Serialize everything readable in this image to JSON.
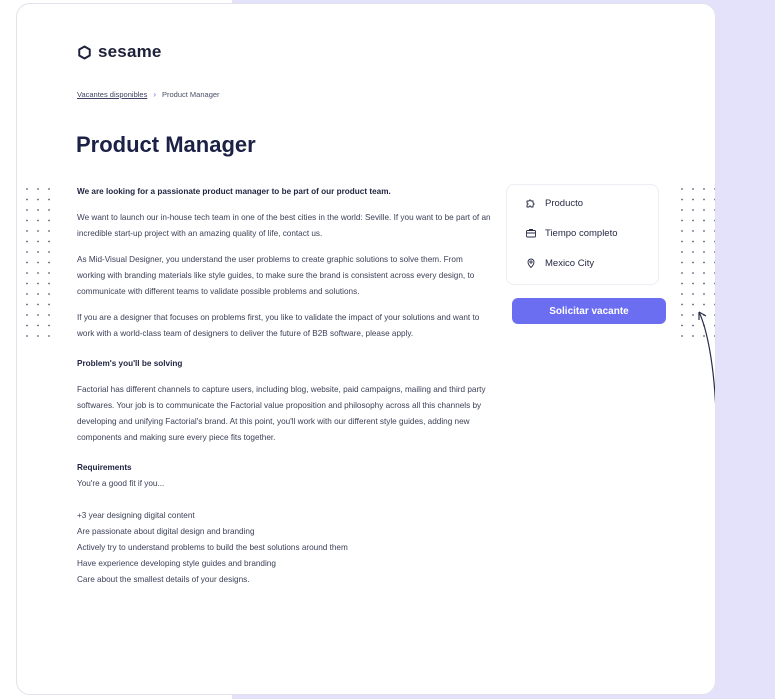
{
  "brand": {
    "name": "sesame"
  },
  "breadcrumb": {
    "parent": "Vacantes disponibles",
    "separator": "›",
    "current": "Product Manager"
  },
  "job": {
    "title": "Product Manager",
    "lead": "We are looking for a passionate product manager to be part of our product team.",
    "paragraphs": [
      "We want to launch our in-house tech team in one of the best cities in the world: Seville. If you want to be part of an incredible start-up project with an amazing quality of life, contact us.",
      "As Mid-Visual Designer, you understand the user problems to create graphic solutions to solve them. From working with branding materials like style guides, to make sure the brand is consistent across every design, to communicate with different teams to validate possible problems and solutions.",
      "If you are a designer that focuses on problems first, you like to validate the impact of your solutions and want to work with a world-class team of designers to deliver the future of B2B software, please apply."
    ],
    "problems_heading": "Problem's you'll be solving",
    "problems_text": "Factorial has different channels to capture users, including blog, website, paid campaigns, mailing and third party softwares. Your job is to communicate the Factorial value proposition and philosophy across all this channels by developing and unifying Factorial's brand. At this point, you'll work with our different style guides, adding new components and making sure every piece fits together.",
    "requirements_heading": "Requirements",
    "requirements_intro": "You're a good fit if you...",
    "requirements": [
      "+3 year designing digital content",
      "Are passionate about digital design and branding",
      "Actively try to understand problems to build the best solutions around them",
      "Have experience developing style guides and branding",
      "Care about the smallest details of your designs."
    ]
  },
  "details": {
    "department": "Producto",
    "schedule": "Tiempo completo",
    "location": "Mexico City"
  },
  "apply_button": {
    "label": "Solicitar vacante"
  },
  "icons": {
    "department": "puzzle-icon",
    "schedule": "briefcase-icon",
    "location": "location-pin-icon"
  },
  "colors": {
    "accent": "#6c6ef2",
    "background": "#e4e2fb",
    "text": "#1f2340"
  }
}
